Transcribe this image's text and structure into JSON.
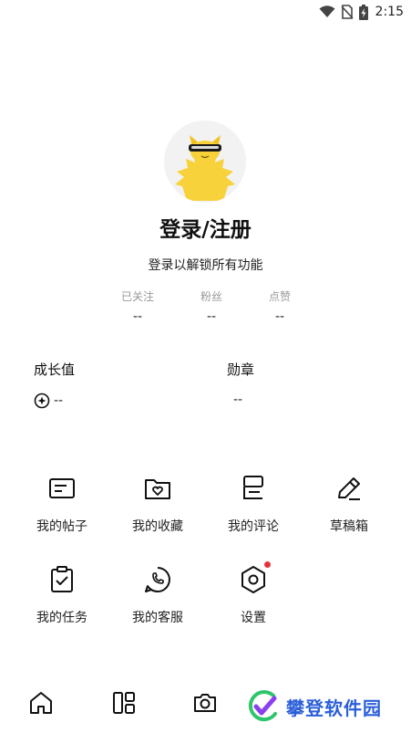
{
  "status_bar": {
    "time": "2:15"
  },
  "profile": {
    "login_title": "登录/注册",
    "login_subtitle": "登录以解锁所有功能"
  },
  "stats": [
    {
      "label": "已关注",
      "value": "--"
    },
    {
      "label": "粉丝",
      "value": "--"
    },
    {
      "label": "点赞",
      "value": "--"
    }
  ],
  "growth": {
    "label": "成长值",
    "value": "--"
  },
  "medal": {
    "label": "勋章",
    "value": "--"
  },
  "grid": [
    {
      "label": "我的帖子",
      "icon": "post-icon"
    },
    {
      "label": "我的收藏",
      "icon": "favorite-folder-icon"
    },
    {
      "label": "我的评论",
      "icon": "comment-icon"
    },
    {
      "label": "草稿箱",
      "icon": "pencil-icon"
    },
    {
      "label": "我的任务",
      "icon": "task-clipboard-icon"
    },
    {
      "label": "我的客服",
      "icon": "phone-chat-icon"
    },
    {
      "label": "设置",
      "icon": "settings-hexagon-icon"
    }
  ],
  "bottom_nav": [
    {
      "icon": "home-icon"
    },
    {
      "icon": "layout-icon"
    },
    {
      "icon": "camera-icon"
    }
  ],
  "watermark": {
    "text": "攀登软件园"
  },
  "colors": {
    "accent_red": "#e5333a",
    "watermark_blue": "#2b5fd9",
    "mascot_yellow": "#f7d23a"
  }
}
